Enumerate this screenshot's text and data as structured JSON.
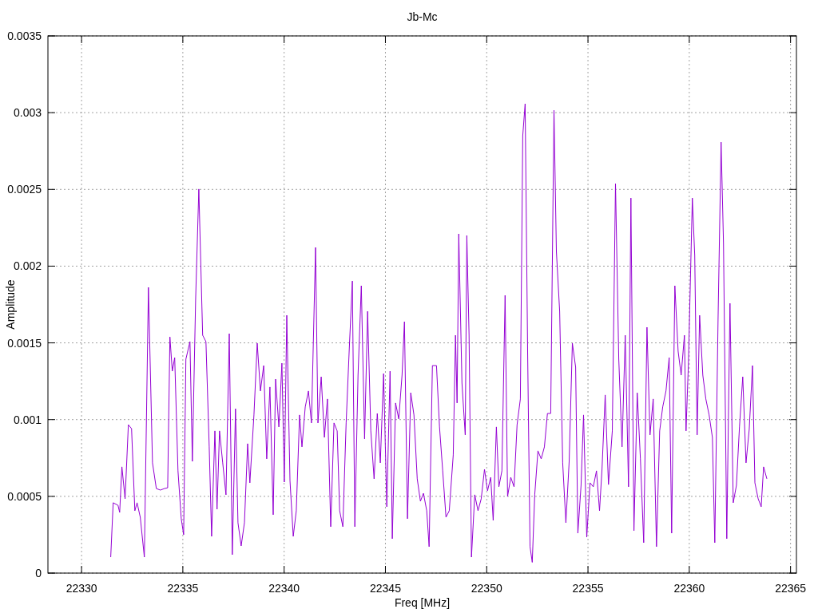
{
  "chart_data": {
    "type": "line",
    "title": "Jb-Mc",
    "xlabel": "Freq [MHz]",
    "ylabel": "Amplitude",
    "x": [
      22331.44,
      22331.56,
      22331.8,
      22331.88,
      22331.99,
      22332.15,
      22332.31,
      22332.47,
      22332.63,
      22332.74,
      22332.9,
      22333.1,
      22333.3,
      22333.5,
      22333.69,
      22333.89,
      22334.09,
      22334.25,
      22334.36,
      22334.48,
      22334.6,
      22334.76,
      22334.92,
      22335.04,
      22335.15,
      22335.35,
      22335.47,
      22335.63,
      22335.79,
      22335.98,
      22336.14,
      22336.3,
      22336.42,
      22336.58,
      22336.69,
      22336.81,
      22336.97,
      22337.13,
      22337.29,
      22337.44,
      22337.6,
      22337.72,
      22337.88,
      22338.04,
      22338.2,
      22338.31,
      22338.51,
      22338.67,
      22338.83,
      22338.99,
      22339.14,
      22339.3,
      22339.46,
      22339.58,
      22339.74,
      22339.89,
      22340.01,
      22340.13,
      22340.29,
      22340.45,
      22340.6,
      22340.76,
      22340.88,
      22341.04,
      22341.2,
      22341.35,
      22341.55,
      22341.67,
      22341.83,
      22341.99,
      22342.14,
      22342.3,
      22342.46,
      22342.62,
      22342.74,
      22342.9,
      22343.06,
      22343.21,
      22343.37,
      22343.49,
      22343.65,
      22343.81,
      22343.97,
      22344.12,
      22344.28,
      22344.44,
      22344.6,
      22344.75,
      22344.91,
      22345.07,
      22345.23,
      22345.34,
      22345.5,
      22345.66,
      22345.82,
      22345.94,
      22346.09,
      22346.25,
      22346.41,
      22346.57,
      22346.73,
      22346.88,
      22347.04,
      22347.16,
      22347.32,
      22347.52,
      22347.67,
      22347.83,
      22347.99,
      22348.15,
      22348.35,
      22348.46,
      22348.54,
      22348.62,
      22348.78,
      22348.94,
      22349.02,
      22349.13,
      22349.25,
      22349.41,
      22349.57,
      22349.73,
      22349.89,
      22350.04,
      22350.2,
      22350.32,
      22350.48,
      22350.6,
      22350.75,
      22350.91,
      22351.03,
      22351.19,
      22351.35,
      22351.5,
      22351.66,
      22351.78,
      22351.9,
      22352.02,
      22352.14,
      22352.25,
      22352.37,
      22352.53,
      22352.69,
      22352.85,
      22353,
      22353.16,
      22353.32,
      22353.44,
      22353.6,
      22353.75,
      22353.91,
      22354.07,
      22354.23,
      22354.39,
      22354.5,
      22354.66,
      22354.78,
      22354.94,
      22355.1,
      22355.26,
      22355.42,
      22355.57,
      22355.69,
      22355.85,
      22356.01,
      22356.2,
      22356.36,
      22356.52,
      22356.68,
      22356.84,
      22357,
      22357.12,
      22357.27,
      22357.43,
      22357.59,
      22357.75,
      22357.91,
      22358.06,
      22358.22,
      22358.38,
      22358.54,
      22358.69,
      22358.85,
      22359.01,
      22359.13,
      22359.29,
      22359.45,
      22359.6,
      22359.76,
      22359.84,
      22359.96,
      22360.15,
      22360.27,
      22360.39,
      22360.51,
      22360.67,
      22360.82,
      22360.98,
      22361.14,
      22361.26,
      22361.42,
      22361.57,
      22361.69,
      22361.85,
      22362.01,
      22362.17,
      22362.33,
      22362.48,
      22362.64,
      22362.8,
      22362.96,
      22363.12,
      22363.24,
      22363.4,
      22363.55,
      22363.67,
      22363.83
    ],
    "series": [
      {
        "color": "#9400d3",
        "values": [
          0.000104,
          0.000458,
          0.000442,
          0.000395,
          0.000692,
          0.000484,
          0.000967,
          0.000941,
          0.000406,
          0.000458,
          0.000364,
          0.000104,
          0.001862,
          0.000718,
          0.000551,
          0.000541,
          0.000551,
          0.000556,
          0.001539,
          0.001316,
          0.001404,
          0.000666,
          0.000354,
          0.00025,
          0.001394,
          0.001508,
          0.000728,
          0.001784,
          0.002502,
          0.00155,
          0.001508,
          0.000822,
          0.000239,
          0.000926,
          0.000416,
          0.000926,
          0.000718,
          0.00051,
          0.00156,
          0.00012,
          0.001071,
          0.000328,
          0.000177,
          0.000328,
          0.000843,
          0.000588,
          0.00103,
          0.001498,
          0.001186,
          0.001352,
          0.000744,
          0.001212,
          0.00038,
          0.001264,
          0.000952,
          0.001368,
          0.000593,
          0.00168,
          0.000603,
          0.000239,
          0.000406,
          0.00103,
          0.000822,
          0.001082,
          0.001186,
          0.000978,
          0.002122,
          0.000978,
          0.001279,
          0.000884,
          0.001134,
          0.000302,
          0.000978,
          0.000926,
          0.000406,
          0.000302,
          0.000978,
          0.001446,
          0.001903,
          0.000302,
          0.00129,
          0.001872,
          0.000874,
          0.001706,
          0.000926,
          0.000614,
          0.00104,
          0.000718,
          0.0013,
          0.000432,
          0.001316,
          0.000224,
          0.001108,
          0.001004,
          0.00129,
          0.001638,
          0.000354,
          0.001175,
          0.00103,
          0.000614,
          0.000468,
          0.00052,
          0.000406,
          0.000172,
          0.001352,
          0.001352,
          0.000952,
          0.000666,
          0.000364,
          0.000406,
          0.00077,
          0.00155,
          0.001108,
          0.00221,
          0.001238,
          0.0009,
          0.0022,
          0.00155,
          0.000104,
          0.00051,
          0.000406,
          0.000484,
          0.000676,
          0.000536,
          0.000624,
          0.000343,
          0.000952,
          0.000562,
          0.000666,
          0.00181,
          0.000499,
          0.000624,
          0.000562,
          0.000967,
          0.001134,
          0.00285,
          0.003058,
          0.001446,
          0.000172,
          7e-05,
          0.00051,
          0.000796,
          0.000744,
          0.000822,
          0.00104,
          0.00104,
          0.003016,
          0.002096,
          0.001706,
          0.000718,
          0.000328,
          0.000728,
          0.001498,
          0.001342,
          0.00026,
          0.000572,
          0.00103,
          0.000234,
          0.000588,
          0.000562,
          0.000666,
          0.000406,
          0.000676,
          0.00116,
          0.000577,
          0.000926,
          0.002538,
          0.001394,
          0.000822,
          0.00155,
          0.000562,
          0.002444,
          0.000276,
          0.001175,
          0.000744,
          0.000198,
          0.001602,
          0.0009,
          0.001134,
          0.000172,
          0.000926,
          0.001082,
          0.001186,
          0.001404,
          0.00026,
          0.001872,
          0.001446,
          0.00129,
          0.00155,
          0.000926,
          0.001368,
          0.002444,
          0.00207,
          0.0009,
          0.00168,
          0.00129,
          0.001134,
          0.00103,
          0.000884,
          0.000198,
          0.001654,
          0.002808,
          0.002148,
          0.000224,
          0.001758,
          0.000458,
          0.000572,
          0.000952,
          0.001279,
          0.000718,
          0.000936,
          0.001352,
          0.000588,
          0.000484,
          0.000432,
          0.000692,
          0.000614
        ]
      }
    ],
    "grid": true,
    "xlim": [
      22328.34,
      22365.29
    ],
    "ylim": [
      0,
      0.0035
    ],
    "xticks": [
      22330,
      22335,
      22340,
      22345,
      22350,
      22355,
      22360,
      22365
    ],
    "yticks": [
      {
        "value": 0,
        "label": "0"
      },
      {
        "value": 0.0005,
        "label": "0.0005"
      },
      {
        "value": 0.001,
        "label": "0.001"
      },
      {
        "value": 0.0015,
        "label": "0.0015"
      },
      {
        "value": 0.002,
        "label": "0.002"
      },
      {
        "value": 0.0025,
        "label": "0.0025"
      },
      {
        "value": 0.003,
        "label": "0.003"
      },
      {
        "value": 0.0035,
        "label": "0.0035"
      }
    ]
  }
}
